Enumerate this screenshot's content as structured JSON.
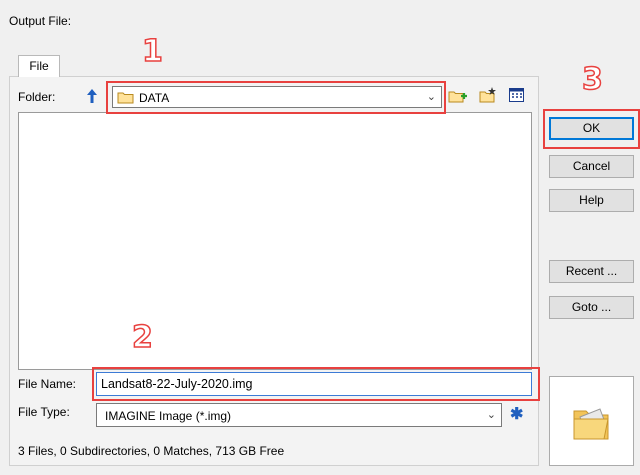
{
  "dialog": {
    "title": "Output File:"
  },
  "tabs": [
    {
      "label": "File"
    }
  ],
  "folder": {
    "label": "Folder:",
    "value": "DATA"
  },
  "file_name": {
    "label": "File Name:",
    "value": "Landsat8-22-July-2020.img"
  },
  "file_type": {
    "label": "File Type:",
    "value": "IMAGINE Image (*.img)"
  },
  "buttons": {
    "ok": "OK",
    "cancel": "Cancel",
    "help": "Help",
    "recent": "Recent ...",
    "goto": "Goto ..."
  },
  "status": "3 Files, 0 Subdirectories, 0 Matches, 713 GB Free",
  "annotations": [
    "1",
    "2",
    "3"
  ],
  "colors": {
    "annotation": "#e8413f",
    "accent": "#0078d7",
    "folder": "#e8b84a"
  },
  "icons": [
    "up-arrow-icon",
    "folder-icon",
    "new-folder-icon",
    "folder-star-icon",
    "details-view-icon",
    "asterisk-icon",
    "preview-folder-icon"
  ]
}
